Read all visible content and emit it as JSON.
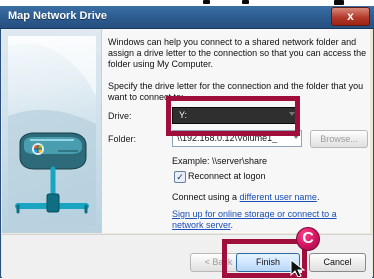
{
  "dialog": {
    "title": "Map Network Drive",
    "close_label": "x",
    "intro": "Windows can help you connect to a shared network folder and assign a drive letter to the connection so that you can access the folder using My Computer.",
    "specify": "Specify the drive letter for the connection and the folder that you want to connect to:",
    "drive_label": "Drive:",
    "drive_value": "Y:",
    "folder_label": "Folder:",
    "folder_value": "\\\\192.168.0.12\\Volume1_",
    "browse_label": "Browse...",
    "example": "Example: \\\\server\\share",
    "reconnect_label": "Reconnect at logon",
    "reconnect_checked": true,
    "connect_prefix": "Connect using a ",
    "connect_link": "different user name",
    "connect_suffix": ".",
    "signup_link": "Sign up for online storage or connect to a network server",
    "signup_suffix": ".",
    "back_label": "< Back",
    "finish_label": "Finish",
    "cancel_label": "Cancel",
    "annotation_letter": "C"
  },
  "colors": {
    "highlight": "#a00f3c",
    "marker": "#cf1560"
  },
  "icons": {
    "graphic": "network-drive-illustration-icon",
    "close": "close-icon",
    "dropdown": "chevron-down-icon",
    "checkbox": "checkmark-icon",
    "cursor": "mouse-pointer-icon"
  }
}
